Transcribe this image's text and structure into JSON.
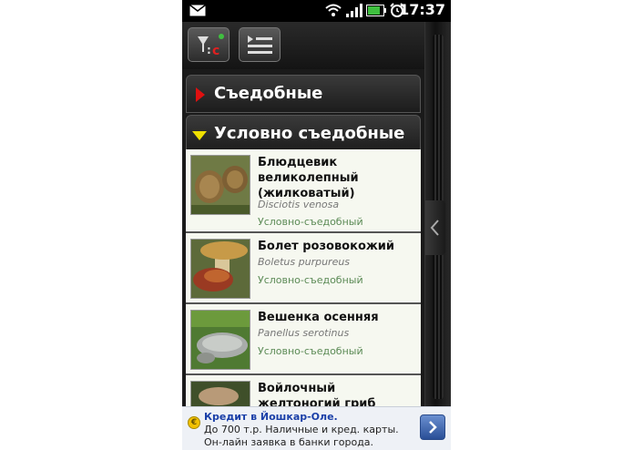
{
  "status_bar": {
    "time": "17:37",
    "icons": [
      "mail-icon",
      "wifi-icon",
      "signal-icon",
      "battery-icon",
      "alarm-icon"
    ]
  },
  "toolbar": {
    "buttons": [
      "filter-icon",
      "list-sort-icon"
    ]
  },
  "groups": [
    {
      "label": "Съедобные",
      "expanded": false
    },
    {
      "label": "Условно съедобные",
      "expanded": true
    }
  ],
  "items": [
    {
      "name": "Блюдцевик великолепный (жилковатый)",
      "latin": "Disciotis venosa",
      "status": "Условно-съедобный"
    },
    {
      "name": "Болет розовокожий",
      "latin": "Boletus purpureus",
      "status": "Условно-съедобный"
    },
    {
      "name": "Вешенка осенняя",
      "latin": "Panellus serotinus",
      "status": "Условно-съедобный"
    },
    {
      "name": "Войлочный желтоногий гриб"
    }
  ],
  "ad": {
    "title": "Кредит в Йошкар-Оле.",
    "text": "До 700 т.р. Наличные и кред. карты. Он-лайн заявка в банки города."
  },
  "colors": {
    "status_green": "#5b8a55",
    "collapsed_arrow": "#e01010",
    "expanded_arrow": "#f0e000",
    "ad_title": "#1a3fa8"
  }
}
